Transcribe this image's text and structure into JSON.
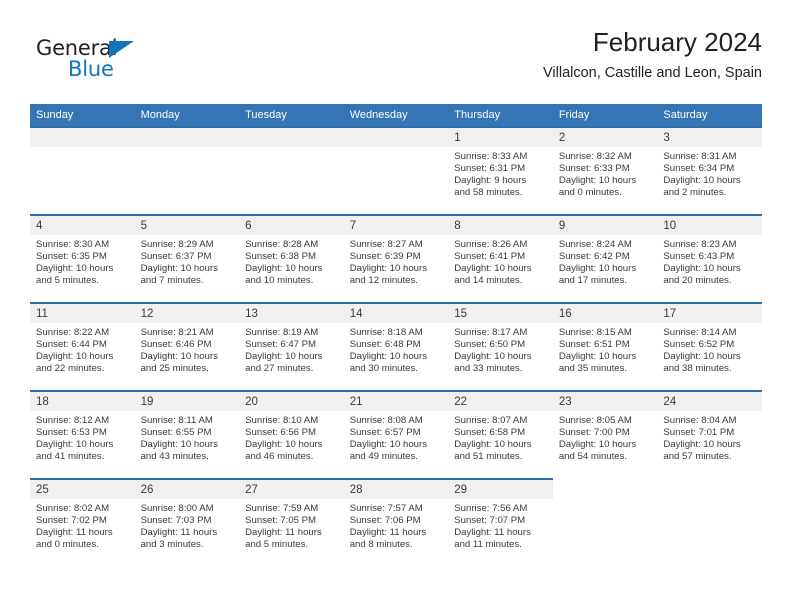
{
  "brand": {
    "name_part1": "General",
    "name_part2": "Blue",
    "accent_color": "#1275bc"
  },
  "header": {
    "title": "February 2024",
    "subtitle": "Villalcon, Castille and Leon, Spain"
  },
  "theme": {
    "header_row_bg": "#3575b5",
    "day_strip_bg": "#f0f0f0",
    "day_strip_border": "#2c6ca8",
    "text_color": "#3a3a3a"
  },
  "calendar": {
    "weekday_headers": [
      "Sunday",
      "Monday",
      "Tuesday",
      "Wednesday",
      "Thursday",
      "Friday",
      "Saturday"
    ],
    "weeks": [
      [
        {
          "day": "",
          "blank": true,
          "strip": true
        },
        {
          "day": "",
          "blank": true,
          "strip": true
        },
        {
          "day": "",
          "blank": true,
          "strip": true
        },
        {
          "day": "",
          "blank": true,
          "strip": true
        },
        {
          "day": "1",
          "sunrise": "Sunrise: 8:33 AM",
          "sunset": "Sunset: 6:31 PM",
          "daylight1": "Daylight: 9 hours",
          "daylight2": "and 58 minutes."
        },
        {
          "day": "2",
          "sunrise": "Sunrise: 8:32 AM",
          "sunset": "Sunset: 6:33 PM",
          "daylight1": "Daylight: 10 hours",
          "daylight2": "and 0 minutes."
        },
        {
          "day": "3",
          "sunrise": "Sunrise: 8:31 AM",
          "sunset": "Sunset: 6:34 PM",
          "daylight1": "Daylight: 10 hours",
          "daylight2": "and 2 minutes."
        }
      ],
      [
        {
          "day": "4",
          "sunrise": "Sunrise: 8:30 AM",
          "sunset": "Sunset: 6:35 PM",
          "daylight1": "Daylight: 10 hours",
          "daylight2": "and 5 minutes."
        },
        {
          "day": "5",
          "sunrise": "Sunrise: 8:29 AM",
          "sunset": "Sunset: 6:37 PM",
          "daylight1": "Daylight: 10 hours",
          "daylight2": "and 7 minutes."
        },
        {
          "day": "6",
          "sunrise": "Sunrise: 8:28 AM",
          "sunset": "Sunset: 6:38 PM",
          "daylight1": "Daylight: 10 hours",
          "daylight2": "and 10 minutes."
        },
        {
          "day": "7",
          "sunrise": "Sunrise: 8:27 AM",
          "sunset": "Sunset: 6:39 PM",
          "daylight1": "Daylight: 10 hours",
          "daylight2": "and 12 minutes."
        },
        {
          "day": "8",
          "sunrise": "Sunrise: 8:26 AM",
          "sunset": "Sunset: 6:41 PM",
          "daylight1": "Daylight: 10 hours",
          "daylight2": "and 14 minutes."
        },
        {
          "day": "9",
          "sunrise": "Sunrise: 8:24 AM",
          "sunset": "Sunset: 6:42 PM",
          "daylight1": "Daylight: 10 hours",
          "daylight2": "and 17 minutes."
        },
        {
          "day": "10",
          "sunrise": "Sunrise: 8:23 AM",
          "sunset": "Sunset: 6:43 PM",
          "daylight1": "Daylight: 10 hours",
          "daylight2": "and 20 minutes."
        }
      ],
      [
        {
          "day": "11",
          "sunrise": "Sunrise: 8:22 AM",
          "sunset": "Sunset: 6:44 PM",
          "daylight1": "Daylight: 10 hours",
          "daylight2": "and 22 minutes."
        },
        {
          "day": "12",
          "sunrise": "Sunrise: 8:21 AM",
          "sunset": "Sunset: 6:46 PM",
          "daylight1": "Daylight: 10 hours",
          "daylight2": "and 25 minutes."
        },
        {
          "day": "13",
          "sunrise": "Sunrise: 8:19 AM",
          "sunset": "Sunset: 6:47 PM",
          "daylight1": "Daylight: 10 hours",
          "daylight2": "and 27 minutes."
        },
        {
          "day": "14",
          "sunrise": "Sunrise: 8:18 AM",
          "sunset": "Sunset: 6:48 PM",
          "daylight1": "Daylight: 10 hours",
          "daylight2": "and 30 minutes."
        },
        {
          "day": "15",
          "sunrise": "Sunrise: 8:17 AM",
          "sunset": "Sunset: 6:50 PM",
          "daylight1": "Daylight: 10 hours",
          "daylight2": "and 33 minutes."
        },
        {
          "day": "16",
          "sunrise": "Sunrise: 8:15 AM",
          "sunset": "Sunset: 6:51 PM",
          "daylight1": "Daylight: 10 hours",
          "daylight2": "and 35 minutes."
        },
        {
          "day": "17",
          "sunrise": "Sunrise: 8:14 AM",
          "sunset": "Sunset: 6:52 PM",
          "daylight1": "Daylight: 10 hours",
          "daylight2": "and 38 minutes."
        }
      ],
      [
        {
          "day": "18",
          "sunrise": "Sunrise: 8:12 AM",
          "sunset": "Sunset: 6:53 PM",
          "daylight1": "Daylight: 10 hours",
          "daylight2": "and 41 minutes."
        },
        {
          "day": "19",
          "sunrise": "Sunrise: 8:11 AM",
          "sunset": "Sunset: 6:55 PM",
          "daylight1": "Daylight: 10 hours",
          "daylight2": "and 43 minutes."
        },
        {
          "day": "20",
          "sunrise": "Sunrise: 8:10 AM",
          "sunset": "Sunset: 6:56 PM",
          "daylight1": "Daylight: 10 hours",
          "daylight2": "and 46 minutes."
        },
        {
          "day": "21",
          "sunrise": "Sunrise: 8:08 AM",
          "sunset": "Sunset: 6:57 PM",
          "daylight1": "Daylight: 10 hours",
          "daylight2": "and 49 minutes."
        },
        {
          "day": "22",
          "sunrise": "Sunrise: 8:07 AM",
          "sunset": "Sunset: 6:58 PM",
          "daylight1": "Daylight: 10 hours",
          "daylight2": "and 51 minutes."
        },
        {
          "day": "23",
          "sunrise": "Sunrise: 8:05 AM",
          "sunset": "Sunset: 7:00 PM",
          "daylight1": "Daylight: 10 hours",
          "daylight2": "and 54 minutes."
        },
        {
          "day": "24",
          "sunrise": "Sunrise: 8:04 AM",
          "sunset": "Sunset: 7:01 PM",
          "daylight1": "Daylight: 10 hours",
          "daylight2": "and 57 minutes."
        }
      ],
      [
        {
          "day": "25",
          "sunrise": "Sunrise: 8:02 AM",
          "sunset": "Sunset: 7:02 PM",
          "daylight1": "Daylight: 11 hours",
          "daylight2": "and 0 minutes."
        },
        {
          "day": "26",
          "sunrise": "Sunrise: 8:00 AM",
          "sunset": "Sunset: 7:03 PM",
          "daylight1": "Daylight: 11 hours",
          "daylight2": "and 3 minutes."
        },
        {
          "day": "27",
          "sunrise": "Sunrise: 7:59 AM",
          "sunset": "Sunset: 7:05 PM",
          "daylight1": "Daylight: 11 hours",
          "daylight2": "and 5 minutes."
        },
        {
          "day": "28",
          "sunrise": "Sunrise: 7:57 AM",
          "sunset": "Sunset: 7:06 PM",
          "daylight1": "Daylight: 11 hours",
          "daylight2": "and 8 minutes."
        },
        {
          "day": "29",
          "sunrise": "Sunrise: 7:56 AM",
          "sunset": "Sunset: 7:07 PM",
          "daylight1": "Daylight: 11 hours",
          "daylight2": "and 11 minutes."
        },
        {
          "day": "",
          "blank": true,
          "strip": false
        },
        {
          "day": "",
          "blank": true,
          "strip": false
        }
      ]
    ]
  }
}
